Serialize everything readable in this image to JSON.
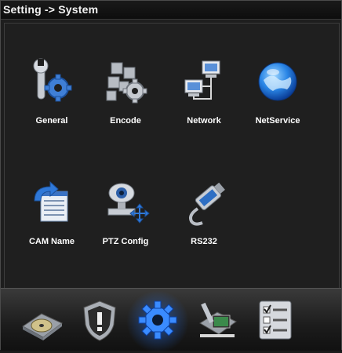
{
  "window": {
    "title": "Setting -> System"
  },
  "menu": {
    "items": [
      {
        "label": "General",
        "icon": "wrench-gear-icon"
      },
      {
        "label": "Encode",
        "icon": "encode-cubes-icon"
      },
      {
        "label": "Network",
        "icon": "network-computers-icon"
      },
      {
        "label": "NetService",
        "icon": "globe-icon"
      },
      {
        "label": "CAM Name",
        "icon": "cam-name-icon"
      },
      {
        "label": "PTZ Config",
        "icon": "ptz-camera-icon"
      },
      {
        "label": "RS232",
        "icon": "serial-connector-icon"
      }
    ]
  },
  "dock": {
    "items": [
      {
        "icon": "disk-icon"
      },
      {
        "icon": "shield-alert-icon"
      },
      {
        "icon": "gear-icon",
        "active": true
      },
      {
        "icon": "tools-monitor-icon"
      },
      {
        "icon": "checklist-icon"
      }
    ]
  },
  "colors": {
    "accent": "#2a7dff",
    "background": "#1e1e1e",
    "text": "#ffffff"
  }
}
